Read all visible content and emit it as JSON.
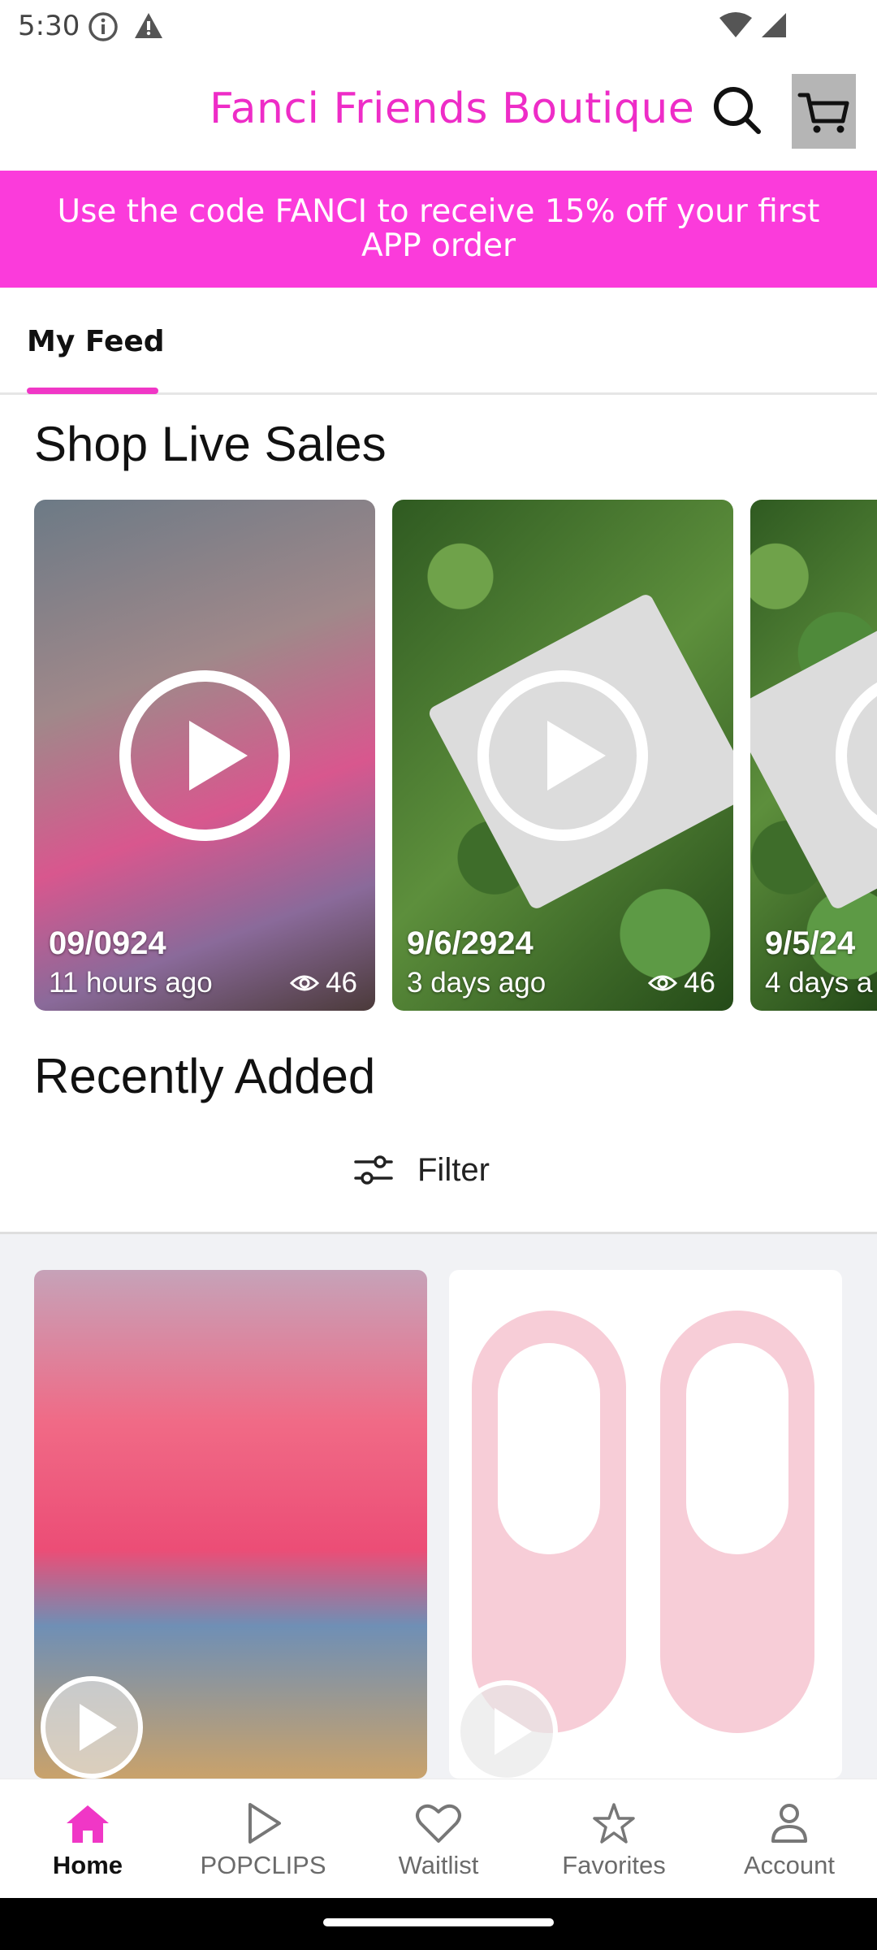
{
  "status_bar": {
    "time": "5:30",
    "icons": [
      "info-icon",
      "alert-icon",
      "wifi-icon",
      "signal-icon"
    ]
  },
  "header": {
    "title": "Fanci Friends Boutique",
    "title_color": "#ee2cc7",
    "search_icon": "search-icon",
    "cart_icon": "cart-icon"
  },
  "promo": {
    "text": "Use the code FANCI to receive 15% off your first APP order",
    "background": "#fb3bdb"
  },
  "tabs": [
    {
      "label": "My Feed",
      "active": true
    }
  ],
  "live_sales": {
    "title": "Shop Live Sales",
    "items": [
      {
        "date": "09/0924",
        "ago": "11 hours ago",
        "views": "46"
      },
      {
        "date": "9/6/2924",
        "ago": "3 days ago",
        "views": "46"
      },
      {
        "date": "9/5/24",
        "ago": "4 days a"
      }
    ]
  },
  "recently_added": {
    "title": "Recently Added",
    "filter_label": "Filter"
  },
  "bottom_nav": [
    {
      "label": "Home",
      "icon": "home-icon",
      "active": true
    },
    {
      "label": "POPCLIPS",
      "icon": "play-icon",
      "active": false
    },
    {
      "label": "Waitlist",
      "icon": "heart-icon",
      "active": false
    },
    {
      "label": "Favorites",
      "icon": "star-icon",
      "active": false
    },
    {
      "label": "Account",
      "icon": "account-icon",
      "active": false
    }
  ],
  "colors": {
    "accent": "#f037c6"
  }
}
